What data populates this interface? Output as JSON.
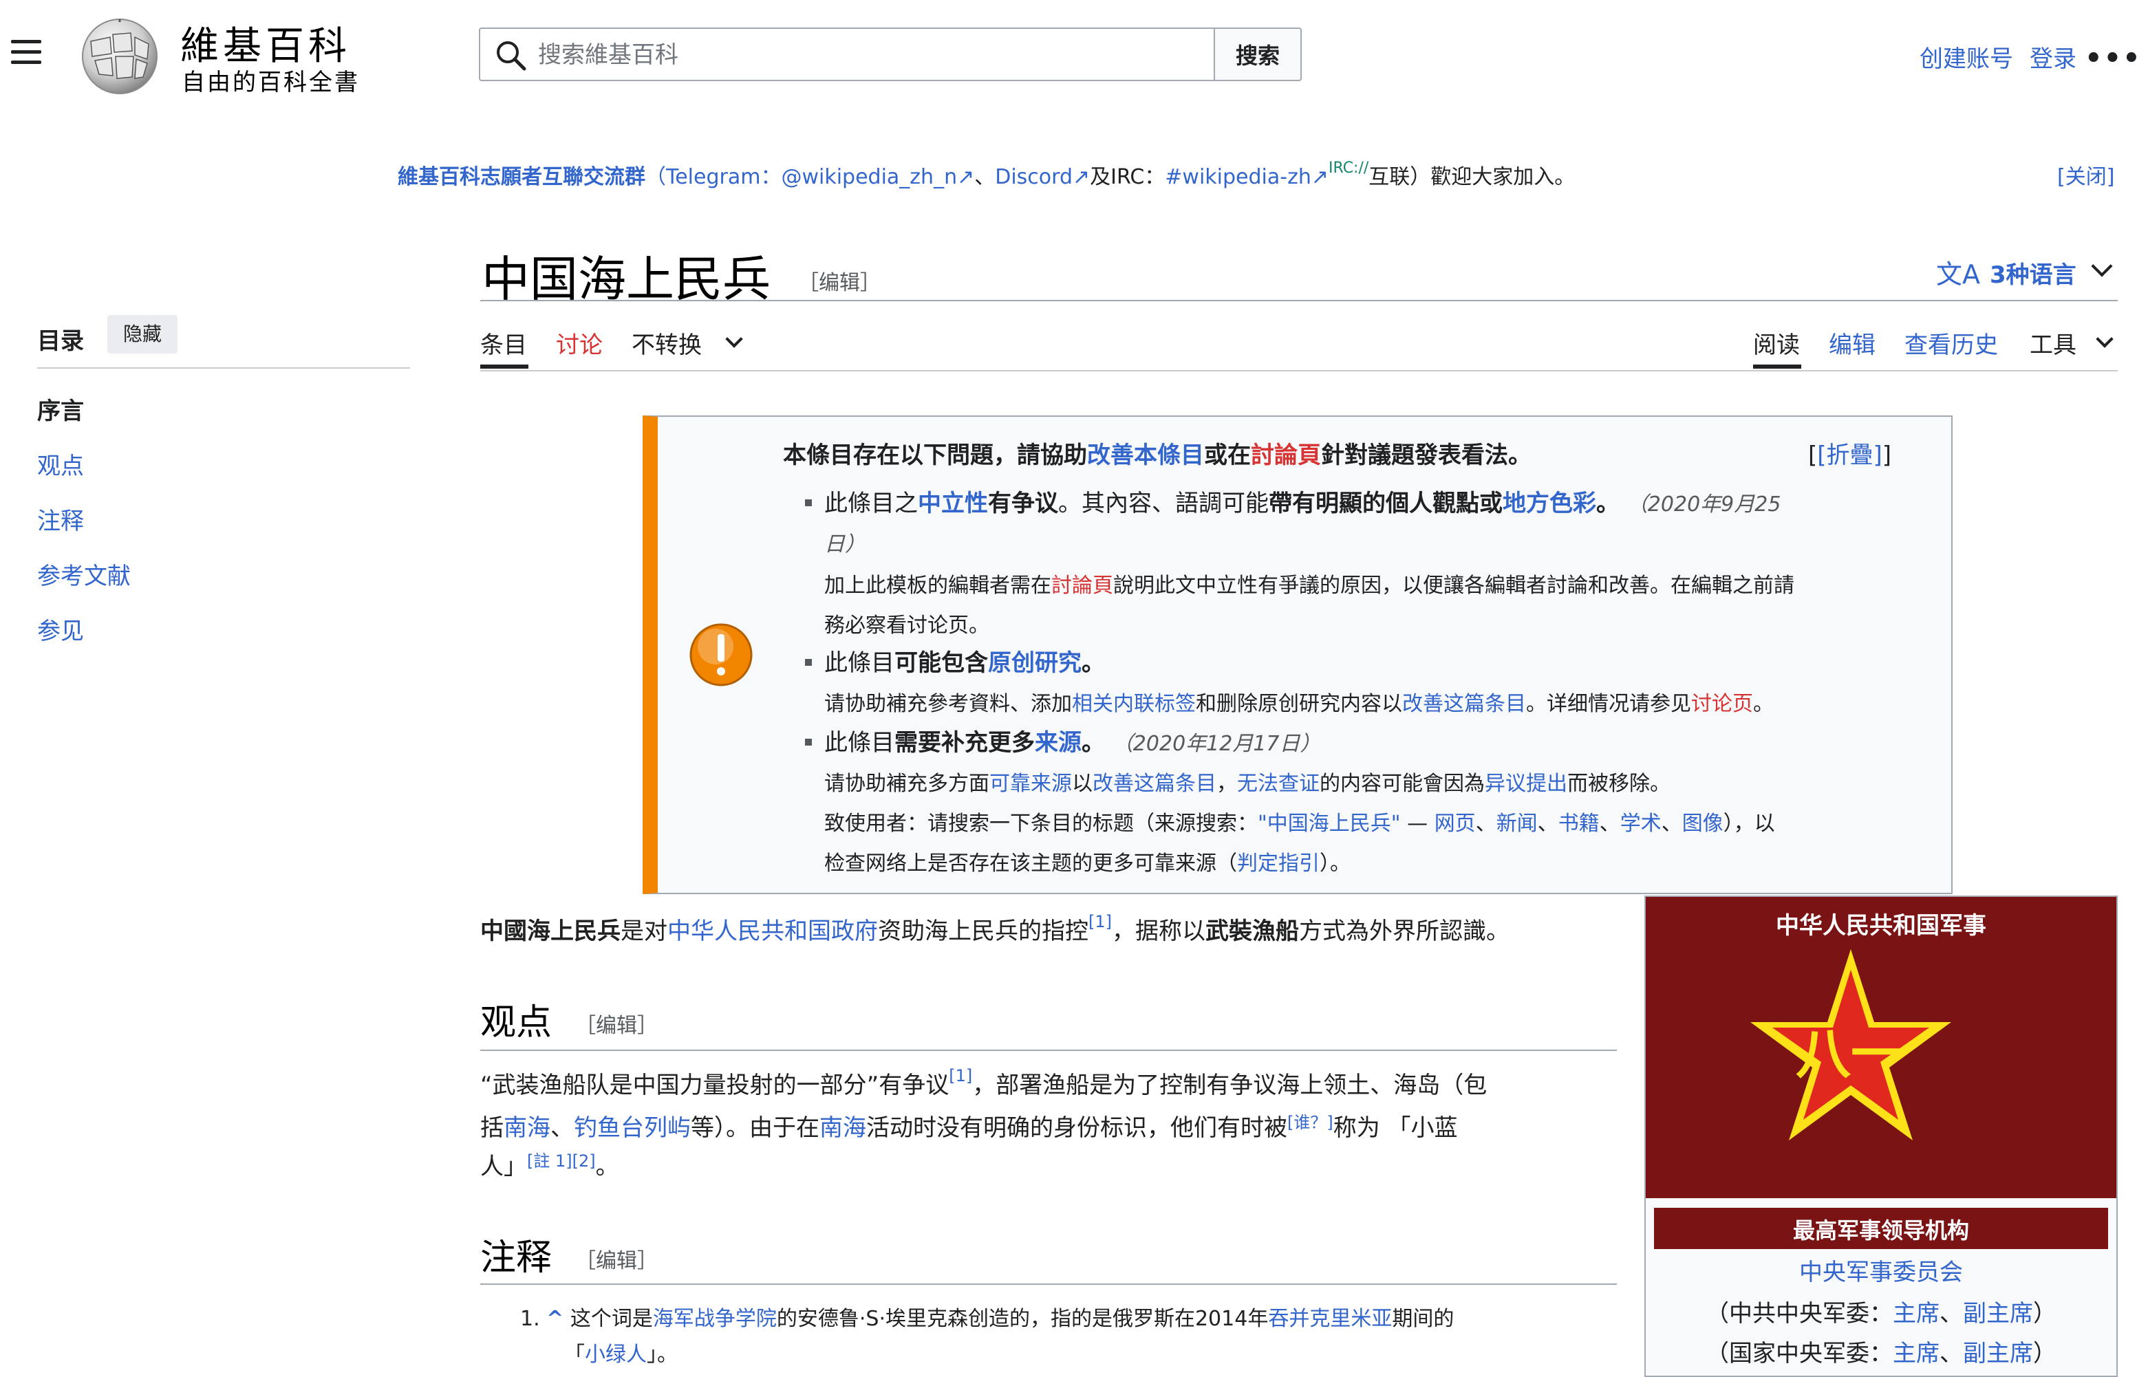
{
  "header": {
    "wordmark": "維基百科",
    "tagline": "自由的百科全書",
    "search_placeholder": "搜索維基百科",
    "search_button": "搜索",
    "create_account": "创建账号",
    "login": "登录",
    "more": "•••"
  },
  "sitenotice": {
    "group": "維基百科志願者互聯交流群",
    "open_paren": "（Telegram：",
    "telegram": "@wikipedia_zh_n",
    "sep1": "、",
    "discord": "Discord",
    "and": "及IRC：",
    "irc": "#wikipedia-zh",
    "irc_sup": "IRC://",
    "irc_tail": "互联）歡迎大家加入。",
    "close": "[关闭]"
  },
  "toc": {
    "title": "目录",
    "hide": "隐藏",
    "items": [
      "序言",
      "观点",
      "注释",
      "参考文献",
      "参见"
    ]
  },
  "page": {
    "title": "中国海上民兵",
    "edit": "［编辑］",
    "lang_count": "3种语言"
  },
  "tabs": {
    "article": "条目",
    "talk": "讨论",
    "variant": "不转换",
    "read": "阅读",
    "edit": "编辑",
    "history": "查看历史",
    "tools": "工具"
  },
  "ambox": {
    "header_pre": "本條目存在以下問題，請協助",
    "header_link1": "改善本條目",
    "header_mid": "或在",
    "header_link2": "討論頁",
    "header_post": "針對議題發表看法。",
    "collapse": "[折疊]",
    "issue1": {
      "a": "此條目之",
      "link": "中立性",
      "b": "有争议",
      "c": "。其內容、語調可能",
      "d": "帶有明顯的個人觀點或",
      "link2": "地方色彩",
      "e": "。",
      "date1": "（2020年9月25",
      "date2": "日）",
      "sub1_a": "加上此模板的編輯者需在",
      "sub1_link": "討論頁",
      "sub1_b": "說明此文中立性有爭議的原因，以便讓各編輯者討論和改善。在編輯之前請",
      "sub2": "務必察看讨论页。"
    },
    "issue2": {
      "a": "此條目",
      "b": "可能包含",
      "link": "原创研究",
      "c": "。",
      "sub_a": "请协助補充參考資料、添加",
      "sub_link1": "相关内联标签",
      "sub_b": "和删除原创研究内容以",
      "sub_link2": "改善这篇条目",
      "sub_c": "。详细情况请参见",
      "sub_link3": "讨论页",
      "sub_d": "。"
    },
    "issue3": {
      "a": "此條目",
      "b": "需要补充更多",
      "link": "来源",
      "c": "。",
      "date": "（2020年12月17日）",
      "sub1_a": "请协助補充多方面",
      "sub1_link1": "可靠来源",
      "sub1_b": "以",
      "sub1_link2": "改善这篇条目",
      "sub1_c": "，",
      "sub1_link3": "无法查证",
      "sub1_d": "的内容可能會因為",
      "sub1_link4": "异议提出",
      "sub1_e": "而被移除。",
      "sub2_a": "致使用者：请搜索一下条目的标题（来源搜索：",
      "sub2_q": "\"中国海上民兵\"",
      "sub2_dash": " — ",
      "sub2_l1": "网页",
      "sub2_l2": "新闻",
      "sub2_l3": "书籍",
      "sub2_l4": "学术",
      "sub2_l5": "图像",
      "sep": "、",
      "sub2_b": "），以",
      "sub3_a": "检查网络上是否存在该主题的更多可靠来源（",
      "sub3_link": "判定指引",
      "sub3_b": "）。"
    }
  },
  "lead": {
    "a": "中國海上民兵",
    "b": "是对",
    "link": "中华人民共和国政府",
    "c": "资助海上民兵的指控",
    "ref": "[1]",
    "d": "，据称以",
    "e": "武裝漁船",
    "f": "方式為外界所認識。"
  },
  "section1": {
    "title": "观点",
    "edit": "［编辑］",
    "l1_a": "“武装渔船队是中国力量投射的一部分”有争议",
    "l1_ref": "[1]",
    "l1_b": "，部署渔船是为了控制有争议海上领土、海岛（包",
    "l2_a": "括",
    "l2_link1": "南海",
    "l2_sep": "、",
    "l2_link2": "钓鱼台列屿",
    "l2_b": "等）。由于在",
    "l2_link3": "南海",
    "l2_c": "活动时没有明确的身份标识，他们有时被",
    "l2_ref": "[谁？]",
    "l2_d": "称为 「小蓝",
    "l3_a": "人」",
    "l3_ref": "[註 1][2]",
    "l3_b": "。"
  },
  "section2": {
    "title": "注释",
    "edit": "［编辑］",
    "n1_num": "1.",
    "n1_caret": "^",
    "n1_a": "这个词是",
    "n1_link1": "海军战争学院",
    "n1_b": "的安德鲁·S·埃里克森创造的，指的是俄罗斯在2014年",
    "n1_link2": "吞并克里米亚",
    "n1_c": "期间的",
    "n1_d": "「",
    "n1_link3": "小绿人",
    "n1_e": "」。"
  },
  "infobox": {
    "title": "中华人民共和国军事",
    "section": "最高军事领导机构",
    "row1_link": "中央军事委员会",
    "row2_a": "（中共中央军委：",
    "row2_l1": "主席",
    "row2_sep": "、",
    "row2_l2": "副主席",
    "row2_b": "）",
    "row3_a": "（国家中央军委：",
    "row3_l1": "主席",
    "row3_sep": "、",
    "row3_l2": "副主席",
    "row3_b": "）"
  },
  "colors": {
    "link": "#3366cc",
    "redlink": "#d73333",
    "ambox_accent": "#f28500",
    "infobox_red": "#7a1414",
    "star_red": "#e0281e",
    "star_yellow": "#ffe11a"
  }
}
